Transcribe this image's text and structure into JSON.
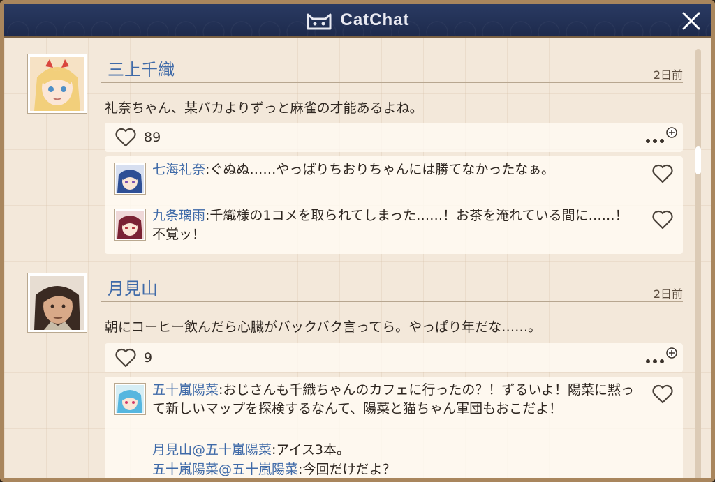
{
  "app": {
    "title": "CatChat"
  },
  "posts": [
    {
      "author": "三上千織",
      "time": "2日前",
      "text": "礼奈ちゃん、某バカよりずっと麻雀の才能あるよね。",
      "likes": "89",
      "replies": [
        {
          "name": "七海礼奈",
          "text": "ぐぬぬ……やっぱりちおりちゃんには勝てなかったなぁ。"
        },
        {
          "name": "九条璃雨",
          "text": "千織様の1コメを取られてしまった……！お茶を淹れている間に……！不覚ッ！"
        }
      ]
    },
    {
      "author": "月見山",
      "time": "2日前",
      "text": "朝にコーヒー飲んだら心臓がバックバク言ってら。やっぱり年だな……。",
      "likes": "9",
      "replies": [
        {
          "name": "五十嵐陽菜",
          "text": "おじさんも千織ちゃんのカフェに行ったの？！ずるいよ！陽菜に黙って新しいマップを探検するなんて、陽菜と猫ちゃん軍団もおこだよ！"
        }
      ],
      "mentions": [
        {
          "from": "月見山",
          "to": "五十嵐陽菜",
          "text": "アイス3本。"
        },
        {
          "from": "五十嵐陽菜",
          "to": "五十嵐陽菜",
          "text": "今回だけだよ？"
        }
      ]
    }
  ],
  "colors": {
    "name_blue": "#3f6aa8",
    "frame": "#a9865d",
    "titlebar": "#1d2a4c"
  }
}
